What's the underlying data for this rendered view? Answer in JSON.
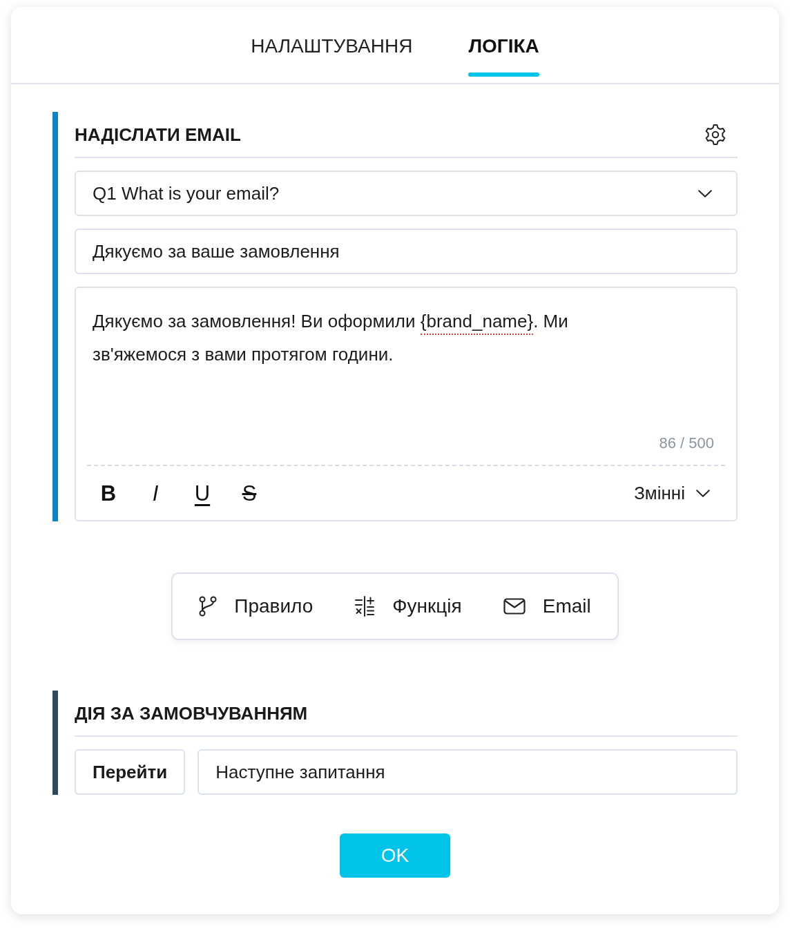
{
  "tabs": [
    {
      "label": "НАЛАШТУВАННЯ",
      "selected": false
    },
    {
      "label": "ЛОГІКА",
      "selected": true
    }
  ],
  "email_rule": {
    "title": "НАДІСЛАТИ EMAIL",
    "color": "#0a84c6",
    "question": {
      "value": "Q1 What is your email?"
    },
    "subject": {
      "value": "Дякуємо за ваше замовлення"
    },
    "message": {
      "body": [
        {
          "text": "Дякуємо за замовлення! Ви оформили ",
          "misspelled": false
        },
        {
          "text": "{brand_name}",
          "misspelled": true
        },
        {
          "text": ". Ми зв'яжемося з вами протягом години.",
          "misspelled": false
        }
      ],
      "counter": "86 / 500",
      "format_buttons": [
        {
          "kind": "bold",
          "label": "B"
        },
        {
          "kind": "italic",
          "label": "I"
        },
        {
          "kind": "underline",
          "label": "U"
        },
        {
          "kind": "strikethrough",
          "label": "S"
        }
      ],
      "variables_button": "Змінні"
    }
  },
  "add_buttons": [
    {
      "kind": "rule",
      "label": "Правило"
    },
    {
      "kind": "function",
      "label": "Функція"
    },
    {
      "kind": "email",
      "label": "Email"
    }
  ],
  "default_action": {
    "title": "ДІЯ ЗА ЗАМОВЧУВАННЯМ",
    "color": "#2e4a5f",
    "action": "Перейти",
    "target": {
      "value": "Наступне запитання"
    }
  },
  "ok_button": "OK"
}
